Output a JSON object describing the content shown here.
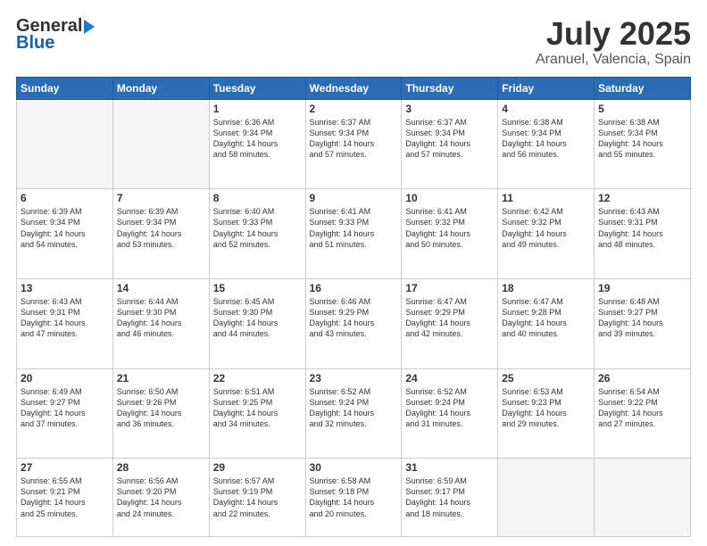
{
  "header": {
    "logo_general": "General",
    "logo_blue": "Blue",
    "month_title": "July 2025",
    "location": "Aranuel, Valencia, Spain"
  },
  "days_of_week": [
    "Sunday",
    "Monday",
    "Tuesday",
    "Wednesday",
    "Thursday",
    "Friday",
    "Saturday"
  ],
  "weeks": [
    [
      {
        "num": "",
        "info": ""
      },
      {
        "num": "",
        "info": ""
      },
      {
        "num": "1",
        "info": "Sunrise: 6:36 AM\nSunset: 9:34 PM\nDaylight: 14 hours\nand 58 minutes."
      },
      {
        "num": "2",
        "info": "Sunrise: 6:37 AM\nSunset: 9:34 PM\nDaylight: 14 hours\nand 57 minutes."
      },
      {
        "num": "3",
        "info": "Sunrise: 6:37 AM\nSunset: 9:34 PM\nDaylight: 14 hours\nand 57 minutes."
      },
      {
        "num": "4",
        "info": "Sunrise: 6:38 AM\nSunset: 9:34 PM\nDaylight: 14 hours\nand 56 minutes."
      },
      {
        "num": "5",
        "info": "Sunrise: 6:38 AM\nSunset: 9:34 PM\nDaylight: 14 hours\nand 55 minutes."
      }
    ],
    [
      {
        "num": "6",
        "info": "Sunrise: 6:39 AM\nSunset: 9:34 PM\nDaylight: 14 hours\nand 54 minutes."
      },
      {
        "num": "7",
        "info": "Sunrise: 6:39 AM\nSunset: 9:34 PM\nDaylight: 14 hours\nand 53 minutes."
      },
      {
        "num": "8",
        "info": "Sunrise: 6:40 AM\nSunset: 9:33 PM\nDaylight: 14 hours\nand 52 minutes."
      },
      {
        "num": "9",
        "info": "Sunrise: 6:41 AM\nSunset: 9:33 PM\nDaylight: 14 hours\nand 51 minutes."
      },
      {
        "num": "10",
        "info": "Sunrise: 6:41 AM\nSunset: 9:32 PM\nDaylight: 14 hours\nand 50 minutes."
      },
      {
        "num": "11",
        "info": "Sunrise: 6:42 AM\nSunset: 9:32 PM\nDaylight: 14 hours\nand 49 minutes."
      },
      {
        "num": "12",
        "info": "Sunrise: 6:43 AM\nSunset: 9:31 PM\nDaylight: 14 hours\nand 48 minutes."
      }
    ],
    [
      {
        "num": "13",
        "info": "Sunrise: 6:43 AM\nSunset: 9:31 PM\nDaylight: 14 hours\nand 47 minutes."
      },
      {
        "num": "14",
        "info": "Sunrise: 6:44 AM\nSunset: 9:30 PM\nDaylight: 14 hours\nand 46 minutes."
      },
      {
        "num": "15",
        "info": "Sunrise: 6:45 AM\nSunset: 9:30 PM\nDaylight: 14 hours\nand 44 minutes."
      },
      {
        "num": "16",
        "info": "Sunrise: 6:46 AM\nSunset: 9:29 PM\nDaylight: 14 hours\nand 43 minutes."
      },
      {
        "num": "17",
        "info": "Sunrise: 6:47 AM\nSunset: 9:29 PM\nDaylight: 14 hours\nand 42 minutes."
      },
      {
        "num": "18",
        "info": "Sunrise: 6:47 AM\nSunset: 9:28 PM\nDaylight: 14 hours\nand 40 minutes."
      },
      {
        "num": "19",
        "info": "Sunrise: 6:48 AM\nSunset: 9:27 PM\nDaylight: 14 hours\nand 39 minutes."
      }
    ],
    [
      {
        "num": "20",
        "info": "Sunrise: 6:49 AM\nSunset: 9:27 PM\nDaylight: 14 hours\nand 37 minutes."
      },
      {
        "num": "21",
        "info": "Sunrise: 6:50 AM\nSunset: 9:26 PM\nDaylight: 14 hours\nand 36 minutes."
      },
      {
        "num": "22",
        "info": "Sunrise: 6:51 AM\nSunset: 9:25 PM\nDaylight: 14 hours\nand 34 minutes."
      },
      {
        "num": "23",
        "info": "Sunrise: 6:52 AM\nSunset: 9:24 PM\nDaylight: 14 hours\nand 32 minutes."
      },
      {
        "num": "24",
        "info": "Sunrise: 6:52 AM\nSunset: 9:24 PM\nDaylight: 14 hours\nand 31 minutes."
      },
      {
        "num": "25",
        "info": "Sunrise: 6:53 AM\nSunset: 9:23 PM\nDaylight: 14 hours\nand 29 minutes."
      },
      {
        "num": "26",
        "info": "Sunrise: 6:54 AM\nSunset: 9:22 PM\nDaylight: 14 hours\nand 27 minutes."
      }
    ],
    [
      {
        "num": "27",
        "info": "Sunrise: 6:55 AM\nSunset: 9:21 PM\nDaylight: 14 hours\nand 25 minutes."
      },
      {
        "num": "28",
        "info": "Sunrise: 6:56 AM\nSunset: 9:20 PM\nDaylight: 14 hours\nand 24 minutes."
      },
      {
        "num": "29",
        "info": "Sunrise: 6:57 AM\nSunset: 9:19 PM\nDaylight: 14 hours\nand 22 minutes."
      },
      {
        "num": "30",
        "info": "Sunrise: 6:58 AM\nSunset: 9:18 PM\nDaylight: 14 hours\nand 20 minutes."
      },
      {
        "num": "31",
        "info": "Sunrise: 6:59 AM\nSunset: 9:17 PM\nDaylight: 14 hours\nand 18 minutes."
      },
      {
        "num": "",
        "info": ""
      },
      {
        "num": "",
        "info": ""
      }
    ]
  ]
}
